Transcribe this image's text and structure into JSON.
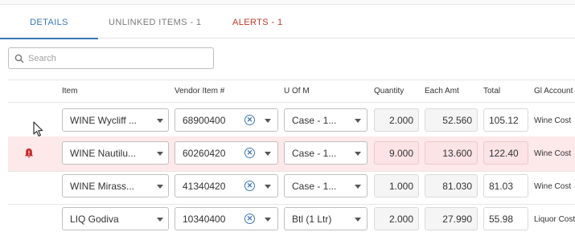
{
  "tabs": [
    {
      "label": "DETAILS"
    },
    {
      "label": "UNLINKED ITEMS - 1"
    },
    {
      "label": "ALERTS - 1"
    }
  ],
  "search": {
    "placeholder": "Search",
    "value": ""
  },
  "columns": [
    "Item",
    "Vendor Item #",
    "U Of M",
    "Quantity",
    "Each Amt",
    "Total",
    "Gl Account"
  ],
  "rows": [
    {
      "item": "WINE Wycliff ...",
      "vendor_item": "68900400",
      "uom": "Case - 1...",
      "quantity": "2.000",
      "each_amt": "52.560",
      "total": "105.12",
      "gl_account": "Wine Cost",
      "alert": false
    },
    {
      "item": "WINE Nautilu...",
      "vendor_item": "60260420",
      "uom": "Case - 1...",
      "quantity": "9.000",
      "each_amt": "13.600",
      "total": "122.40",
      "gl_account": "Wine Cost",
      "alert": true
    },
    {
      "item": "WINE Mirass...",
      "vendor_item": "41340420",
      "uom": "Case - 1...",
      "quantity": "1.000",
      "each_amt": "81.030",
      "total": "81.03",
      "gl_account": "Wine Cost",
      "alert": false
    },
    {
      "item": "LIQ Godiva",
      "vendor_item": "10340400",
      "uom": "Btl (1 Ltr)",
      "quantity": "2.000",
      "each_amt": "27.990",
      "total": "55.98",
      "gl_account": "Liquor Cost",
      "alert": false
    }
  ],
  "icons": {
    "search": "search-icon",
    "alert": "bell-icon",
    "clear": "clear-circle-icon",
    "dropdown": "chevron-down-icon",
    "cursor": "mouse-pointer-icon"
  },
  "colors": {
    "accent": "#3a77b8",
    "alert_text": "#c0392b",
    "alert_row_bg": "#fde8ea",
    "bell": "#c62828"
  }
}
